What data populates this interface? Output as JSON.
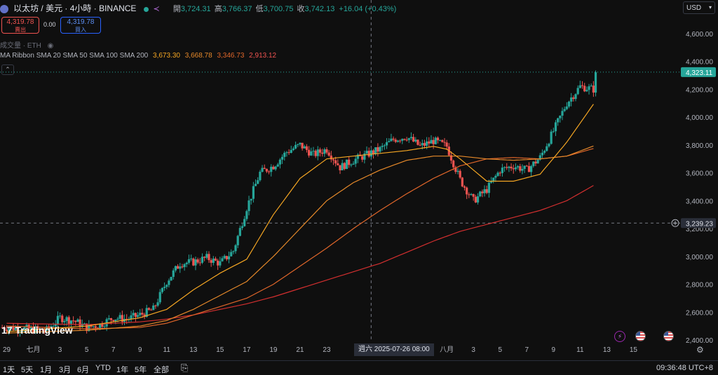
{
  "header": {
    "symbol": "以太坊 / 美元 · 4小時 · BINANCE",
    "ohlc": {
      "open_label": "開",
      "open": "3,724.31",
      "high_label": "高",
      "high": "3,766.37",
      "low_label": "低",
      "low": "3,700.75",
      "close_label": "收",
      "close": "3,742.13",
      "change": "+16.04 (+0.43%)"
    },
    "sell_price": "4,319.78",
    "sell_label": "賣出",
    "spread": "0.00",
    "buy_price": "4,319.78",
    "buy_label": "買入",
    "volume_label": "成交量 · ETH",
    "ma_ribbon": {
      "label": "MA Ribbon SMA 20 SMA 50 SMA 100 SMA 200",
      "v20": "3,673.30",
      "v50": "3,668.78",
      "v100": "3,346.73",
      "v200": "2,913.12"
    },
    "currency": "USD"
  },
  "colors": {
    "up": "#26a69a",
    "down": "#ef5350",
    "sma20": "#f5a623",
    "sma50": "#e6892a",
    "sma100": "#e0662a",
    "sma200": "#d32f2f"
  },
  "chart_data": {
    "type": "candlestick",
    "ylim": [
      2340,
      4740
    ],
    "y_ticks": [
      "4,600.00",
      "4,400.00",
      "4,200.00",
      "4,000.00",
      "3,800.00",
      "3,600.00",
      "3,400.00",
      "3,200.00",
      "3,000.00",
      "2,800.00",
      "2,600.00",
      "2,400.00"
    ],
    "y_tick_values": [
      4600,
      4400,
      4200,
      4000,
      3800,
      3600,
      3400,
      3200,
      3000,
      2800,
      2600,
      2400
    ],
    "x_ticks": [
      "29",
      "七月",
      "3",
      "5",
      "7",
      "9",
      "11",
      "13",
      "15",
      "17",
      "19",
      "21",
      "23",
      "八月",
      "3",
      "5",
      "7",
      "9",
      "11",
      "13",
      "15"
    ],
    "x_tick_days": [
      -1,
      1,
      3,
      5,
      7,
      9,
      11,
      13,
      15,
      17,
      19,
      21,
      23,
      32,
      34,
      36,
      38,
      40,
      42,
      44,
      46
    ],
    "x_range_days": [
      -1.5,
      49.5
    ],
    "last_price": 4323.11,
    "last_price_label": "4,323.11",
    "crosshair": {
      "price": 3239.23,
      "label": "3,239.23",
      "day": 26.33,
      "time_label": "週六 2025-07-26  08:00"
    },
    "anchors_day_close": [
      [
        -1,
        2490
      ],
      [
        2,
        2470
      ],
      [
        3,
        2560
      ],
      [
        4,
        2540
      ],
      [
        5,
        2490
      ],
      [
        6,
        2510
      ],
      [
        7,
        2560
      ],
      [
        8,
        2550
      ],
      [
        9,
        2580
      ],
      [
        10,
        2620
      ],
      [
        11,
        2820
      ],
      [
        12,
        2950
      ],
      [
        13,
        2960
      ],
      [
        14,
        2990
      ],
      [
        15,
        2950
      ],
      [
        16,
        3040
      ],
      [
        17,
        3350
      ],
      [
        18,
        3600
      ],
      [
        19,
        3650
      ],
      [
        20,
        3750
      ],
      [
        21,
        3800
      ],
      [
        22,
        3730
      ],
      [
        23,
        3770
      ],
      [
        24,
        3640
      ],
      [
        25,
        3690
      ],
      [
        26,
        3730
      ],
      [
        27,
        3770
      ],
      [
        28,
        3840
      ],
      [
        29,
        3860
      ],
      [
        30,
        3790
      ],
      [
        31,
        3830
      ],
      [
        32,
        3790
      ],
      [
        33,
        3550
      ],
      [
        34,
        3400
      ],
      [
        35,
        3480
      ],
      [
        36,
        3620
      ],
      [
        37,
        3650
      ],
      [
        38,
        3620
      ],
      [
        39,
        3710
      ],
      [
        40,
        3900
      ],
      [
        41,
        4100
      ],
      [
        42,
        4220
      ],
      [
        43,
        4200
      ],
      [
        43.2,
        4323
      ]
    ],
    "anchors_sma20": [
      [
        -1,
        2460
      ],
      [
        5,
        2500
      ],
      [
        9,
        2560
      ],
      [
        11,
        2620
      ],
      [
        13,
        2760
      ],
      [
        15,
        2880
      ],
      [
        17,
        2980
      ],
      [
        19,
        3300
      ],
      [
        21,
        3560
      ],
      [
        23,
        3700
      ],
      [
        25,
        3720
      ],
      [
        27,
        3740
      ],
      [
        29,
        3760
      ],
      [
        31,
        3790
      ],
      [
        32,
        3770
      ],
      [
        33,
        3700
      ],
      [
        35,
        3540
      ],
      [
        37,
        3540
      ],
      [
        39,
        3590
      ],
      [
        41,
        3820
      ],
      [
        43.2,
        4120
      ]
    ],
    "anchors_sma50": [
      [
        -1,
        2450
      ],
      [
        5,
        2470
      ],
      [
        9,
        2500
      ],
      [
        11,
        2540
      ],
      [
        13,
        2620
      ],
      [
        15,
        2720
      ],
      [
        17,
        2820
      ],
      [
        19,
        3000
      ],
      [
        21,
        3200
      ],
      [
        23,
        3400
      ],
      [
        25,
        3530
      ],
      [
        27,
        3620
      ],
      [
        29,
        3690
      ],
      [
        31,
        3720
      ],
      [
        33,
        3720
      ],
      [
        35,
        3700
      ],
      [
        37,
        3690
      ],
      [
        39,
        3700
      ],
      [
        41,
        3720
      ],
      [
        43.2,
        3800
      ]
    ],
    "anchors_sma100": [
      [
        -1,
        2500
      ],
      [
        5,
        2480
      ],
      [
        9,
        2490
      ],
      [
        11,
        2520
      ],
      [
        13,
        2580
      ],
      [
        15,
        2640
      ],
      [
        17,
        2700
      ],
      [
        19,
        2800
      ],
      [
        21,
        2930
      ],
      [
        23,
        3060
      ],
      [
        25,
        3200
      ],
      [
        27,
        3330
      ],
      [
        29,
        3450
      ],
      [
        31,
        3560
      ],
      [
        33,
        3650
      ],
      [
        35,
        3700
      ],
      [
        37,
        3710
      ],
      [
        39,
        3700
      ],
      [
        41,
        3720
      ],
      [
        43.2,
        3780
      ]
    ],
    "anchors_sma200": [
      [
        -1,
        2520
      ],
      [
        5,
        2510
      ],
      [
        9,
        2530
      ],
      [
        11,
        2550
      ],
      [
        13,
        2580
      ],
      [
        15,
        2620
      ],
      [
        17,
        2660
      ],
      [
        19,
        2710
      ],
      [
        21,
        2770
      ],
      [
        23,
        2830
      ],
      [
        25,
        2890
      ],
      [
        27,
        2950
      ],
      [
        29,
        3030
      ],
      [
        31,
        3110
      ],
      [
        33,
        3180
      ],
      [
        35,
        3230
      ],
      [
        37,
        3280
      ],
      [
        39,
        3330
      ],
      [
        41,
        3400
      ],
      [
        43.2,
        3520
      ]
    ]
  },
  "toolbar": {
    "ranges": [
      "1天",
      "5天",
      "1月",
      "3月",
      "6月",
      "YTD",
      "1年",
      "5年",
      "全部"
    ],
    "time": "09:36:48 UTC+8"
  },
  "brand": "TradingView"
}
